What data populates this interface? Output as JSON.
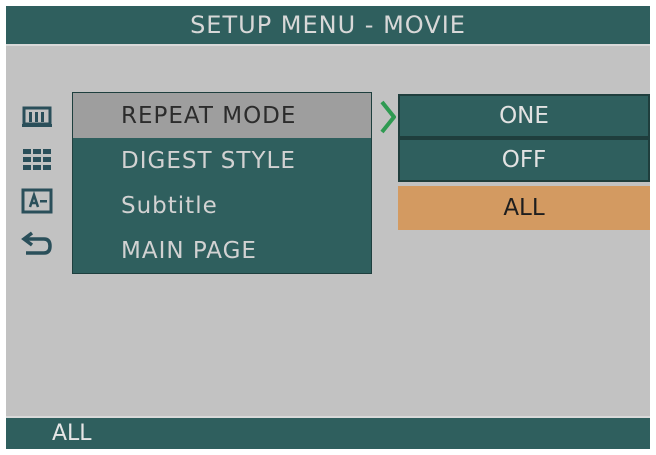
{
  "title": "SETUP MENU - MOVIE",
  "side_icons": [
    {
      "name": "movie-mode-icon"
    },
    {
      "name": "digest-grid-icon"
    },
    {
      "name": "subtitle-icon"
    },
    {
      "name": "return-icon"
    }
  ],
  "menu": {
    "items": [
      {
        "label": "REPEAT MODE",
        "selected": true
      },
      {
        "label": "DIGEST STYLE",
        "selected": false
      },
      {
        "label": "Subtitle",
        "selected": false
      },
      {
        "label": "MAIN PAGE",
        "selected": false
      }
    ]
  },
  "submenu": {
    "options": [
      {
        "label": "ONE",
        "selected": false
      },
      {
        "label": "OFF",
        "selected": false
      },
      {
        "label": "ALL",
        "selected": true
      }
    ]
  },
  "status": {
    "text": "ALL"
  },
  "colors": {
    "panel": "#2f5f5e",
    "highlight": "#d39a61",
    "selected_row": "#9e9e9e",
    "background": "#c2c2c2",
    "arrow": "#2f9a52"
  }
}
